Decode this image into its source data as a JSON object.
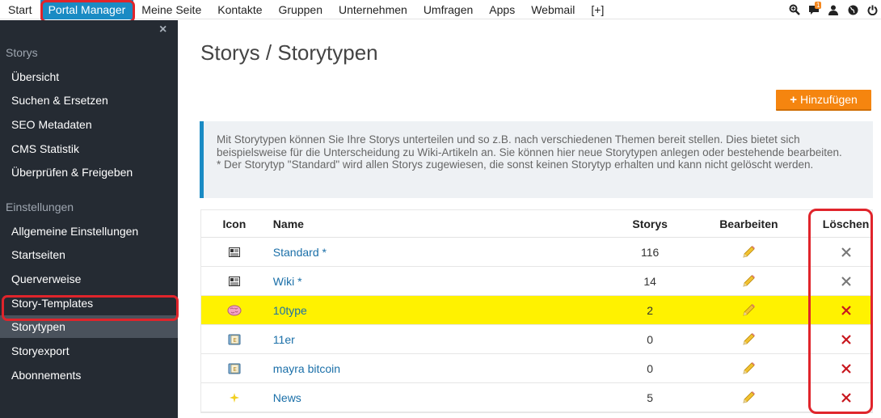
{
  "nav": {
    "items": [
      "Start",
      "Portal Manager",
      "Meine Seite",
      "Kontakte",
      "Gruppen",
      "Unternehmen",
      "Umfragen",
      "Apps",
      "Webmail",
      "[+]"
    ],
    "message_badge": "1"
  },
  "sidebar": {
    "close_glyph": "×",
    "sections": [
      {
        "title": "Storys",
        "items": [
          "Übersicht",
          "Suchen & Ersetzen",
          "SEO Metadaten",
          "CMS Statistik",
          "Überprüfen & Freigeben"
        ]
      },
      {
        "title": "Einstellungen",
        "items": [
          "Allgemeine Einstellungen",
          "Startseiten",
          "Querverweise",
          "Story-Templates",
          "Storytypen",
          "Storyexport",
          "Abonnements"
        ]
      }
    ],
    "active": "Storytypen"
  },
  "main": {
    "title": "Storys / Storytypen",
    "add_button": "Hinzufügen",
    "info_text": "Mit Storytypen können Sie Ihre Storys unterteilen und so z.B. nach verschiedenen Themen bereit stellen. Dies bietet sich beispielsweise für die Unterscheidung zu Wiki-Artikeln an. Sie können hier neue Storytypen anlegen oder bestehende bearbeiten.",
    "info_note": "* Der Storytyp \"Standard\" wird allen Storys zugewiesen, die sonst keinen Storytyp erhalten und kann nicht gelöscht werden."
  },
  "table": {
    "headers": [
      "Icon",
      "Name",
      "Storys",
      "Bearbeiten",
      "Löschen"
    ],
    "rows": [
      {
        "icon": "newspaper-icon",
        "name": "Standard *",
        "storys": "116",
        "deletable": false
      },
      {
        "icon": "newspaper-icon",
        "name": "Wiki *",
        "storys": "14",
        "deletable": false
      },
      {
        "icon": "brain-icon",
        "name": "10type",
        "storys": "2",
        "deletable": true,
        "highlight": true
      },
      {
        "icon": "book-icon",
        "name": "11er",
        "storys": "0",
        "deletable": true
      },
      {
        "icon": "book-icon",
        "name": "mayra bitcoin",
        "storys": "0",
        "deletable": true
      },
      {
        "icon": "sparkle-icon",
        "name": "News",
        "storys": "5",
        "deletable": true
      }
    ]
  },
  "colors": {
    "accent": "#1a8bc4",
    "orange": "#f5850f",
    "highlight": "#fff200",
    "annotation": "#e0242b"
  }
}
